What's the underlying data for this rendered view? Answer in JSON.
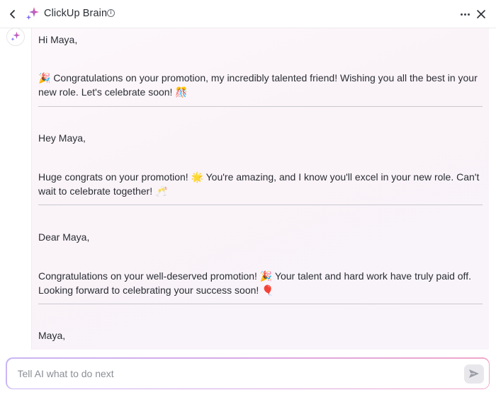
{
  "header": {
    "title": "ClickUp Brain",
    "info_glyph": "i",
    "back_icon": "chevron-left-icon",
    "logo_icon": "sparkles-icon",
    "more_icon": "more-horizontal-icon",
    "close_icon": "close-icon"
  },
  "messages": [
    {
      "greeting": "Hi Maya,",
      "body": "🎉 Congratulations on your promotion, my incredibly talented friend! Wishing you all the best in your new role. Let's celebrate soon! 🎊"
    },
    {
      "greeting": "Hey Maya,",
      "body": "Huge congrats on your promotion! 🌟 You're amazing, and I know you'll excel in your new role. Can't wait to celebrate together! 🥂"
    },
    {
      "greeting": "Dear Maya,",
      "body": "Congratulations on your well-deserved promotion! 🎉 Your talent and hard work have truly paid off. Looking forward to celebrating your success soon! 🎈"
    },
    {
      "greeting": "Maya,"
    }
  ],
  "composer": {
    "placeholder": "Tell AI what to do next",
    "value": "",
    "send_icon": "send-icon"
  },
  "colors": {
    "accent_pink": "#f06292",
    "accent_purple": "#8b5cf6",
    "card_bg": "#faf3f8"
  }
}
